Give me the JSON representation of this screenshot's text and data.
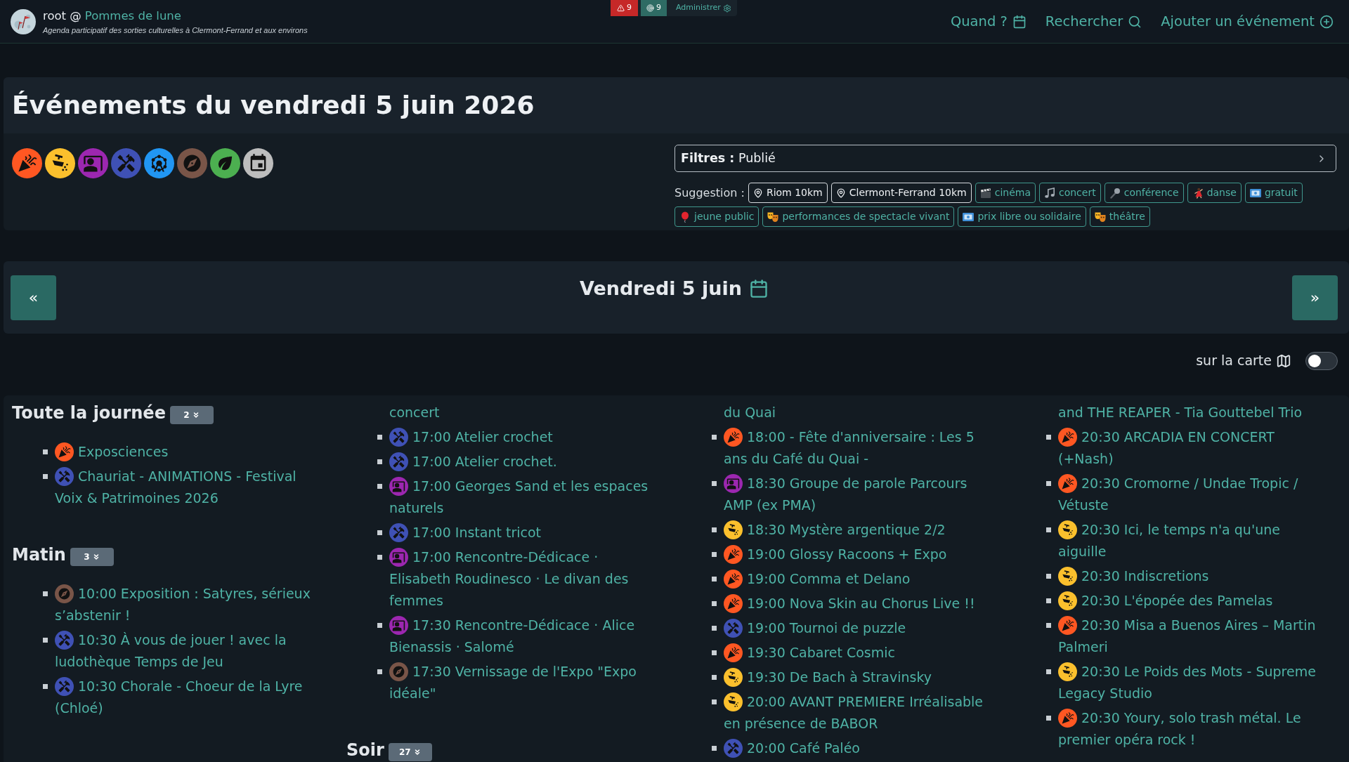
{
  "header": {
    "user": "root @",
    "site_name": "Pommes de lune",
    "tagline": "Agenda participatif des sorties culturelles à Clermont-Ferrand et aux environs"
  },
  "admin_bar": {
    "alerts": "9",
    "pending": "9",
    "link": "Administrer"
  },
  "nav": [
    {
      "kind": "calendar",
      "label": "Quand ?"
    },
    {
      "kind": "search",
      "label": "Rechercher"
    },
    {
      "kind": "add",
      "label": "Ajouter un événement"
    }
  ],
  "title": "Événements du vendredi 5 juin 2026",
  "categories": [
    {
      "kind": "popper",
      "color": "#ff5722"
    },
    {
      "kind": "spotlight",
      "color": "#fbc02d"
    },
    {
      "kind": "presentation",
      "color": "#9c27b0"
    },
    {
      "kind": "tools",
      "color": "#3f51b5"
    },
    {
      "kind": "wheel",
      "color": "#2196f3"
    },
    {
      "kind": "compass",
      "color": "#795548"
    },
    {
      "kind": "leaf",
      "color": "#4caf50"
    },
    {
      "kind": "calendar",
      "color": "#bdbdbd"
    }
  ],
  "filters": {
    "text": "**Filtres :** Publié"
  },
  "suggestions": {
    "label": "Suggestion :",
    "tags": [
      {
        "kind": "place",
        "label": "Riom 10km"
      },
      {
        "kind": "place",
        "label": "Clermont-Ferrand 10km"
      },
      {
        "kind": "clapper",
        "label": "cinéma"
      },
      {
        "kind": "note",
        "label": "concert"
      },
      {
        "kind": "mic",
        "label": "conférence"
      },
      {
        "kind": "dancer",
        "label": "danse"
      },
      {
        "kind": "banknote",
        "label": "gratuit"
      },
      {
        "kind": "balloon",
        "label": "jeune public"
      },
      {
        "kind": "masks",
        "label": "performances de spectacle vivant"
      },
      {
        "kind": "banknote",
        "label": "prix libre ou solidaire"
      },
      {
        "kind": "masks",
        "label": "théâtre"
      }
    ]
  },
  "day_nav": {
    "previous": "«",
    "date": "Vendredi 5 juin",
    "next": "»"
  },
  "map_toggle": {
    "label": "sur la carte",
    "on": false
  },
  "agenda": {
    "columns": [
      {
        "blocks": [
          {
            "kind": "heading",
            "title": "Toute la journée",
            "count": "2"
          },
          {
            "kind": "popper",
            "title": "Exposciences"
          },
          {
            "kind": "tools",
            "title": "Chauriat - ANIMATIONS - Festival Voix & Patrimoines 2026"
          },
          {
            "kind": "heading",
            "title": "Matin",
            "count": "3"
          },
          {
            "kind": "compass",
            "title": "10:00 Exposition : Satyres, sérieux s’abstenir !"
          },
          {
            "kind": "tools",
            "title": "10:30 À vous de jouer ! avec la ludothèque Temps de Jeu"
          },
          {
            "kind": "tools",
            "title": "10:30 Chorale - Choeur de la Lyre (Chloé)"
          }
        ]
      },
      {
        "blocks": [
          {
            "kind": "continuation",
            "text": "concert"
          },
          {
            "kind": "tools",
            "title": "17:00 Atelier crochet"
          },
          {
            "kind": "tools",
            "title": "17:00 Atelier crochet."
          },
          {
            "kind": "presentation",
            "title": "17:00 Georges Sand et les espaces naturels"
          },
          {
            "kind": "tools",
            "title": "17:00 Instant tricot"
          },
          {
            "kind": "presentation",
            "title": "17:00 Rencontre-Dédicace · Elisabeth Roudinesco · Le divan des femmes"
          },
          {
            "kind": "presentation",
            "title": "17:30 Rencontre-Dédicace · Alice Bienassis · Salomé"
          },
          {
            "kind": "compass",
            "title": "17:30 Vernissage de l'Expo \"Expo idéale\""
          },
          {
            "kind": "heading",
            "title": "Soir",
            "count": "27"
          }
        ]
      },
      {
        "blocks": [
          {
            "kind": "continuation",
            "text": "du Quai"
          },
          {
            "kind": "popper",
            "title": "18:00 - Fête d'anniversaire : Les 5 ans du Café du Quai -"
          },
          {
            "kind": "presentation",
            "title": "18:30 Groupe de parole Parcours AMP (ex PMA)"
          },
          {
            "kind": "spotlight",
            "title": "18:30 Mystère argentique 2/2"
          },
          {
            "kind": "popper",
            "title": "19:00 Glossy Racoons + Expo"
          },
          {
            "kind": "popper",
            "title": "19:00 Comma et Delano"
          },
          {
            "kind": "popper",
            "title": "19:00 Nova Skin au Chorus Live !!"
          },
          {
            "kind": "tools",
            "title": "19:00 Tournoi de puzzle"
          },
          {
            "kind": "popper",
            "title": "19:30 Cabaret Cosmic"
          },
          {
            "kind": "spotlight",
            "title": "19:30 De Bach à Stravinsky"
          },
          {
            "kind": "spotlight",
            "title": "20:00 AVANT PREMIERE Irréalisable en présence de BABOR"
          },
          {
            "kind": "tools",
            "title": "20:00 Café Paléo"
          }
        ]
      },
      {
        "blocks": [
          {
            "kind": "continuation",
            "text": "and THE REAPER - Tia Gouttebel Trio"
          },
          {
            "kind": "popper",
            "title": "20:30 ARCADIA EN CONCERT (+Nash)"
          },
          {
            "kind": "popper",
            "title": "20:30 Cromorne / Undae Tropic / Vétuste"
          },
          {
            "kind": "spotlight",
            "title": "20:30 Ici, le temps n'a qu'une aiguille"
          },
          {
            "kind": "spotlight",
            "title": "20:30 Indiscretions"
          },
          {
            "kind": "spotlight",
            "title": "20:30 L'épopée des Pamelas"
          },
          {
            "kind": "popper",
            "title": "20:30 Misa a Buenos Aires – Martin Palmeri"
          },
          {
            "kind": "spotlight",
            "title": "20:30 Le Poids des Mots - Supreme Legacy Studio"
          },
          {
            "kind": "popper",
            "title": "20:30 Youry, solo trash métal. Le premier opéra rock !"
          }
        ]
      }
    ]
  }
}
